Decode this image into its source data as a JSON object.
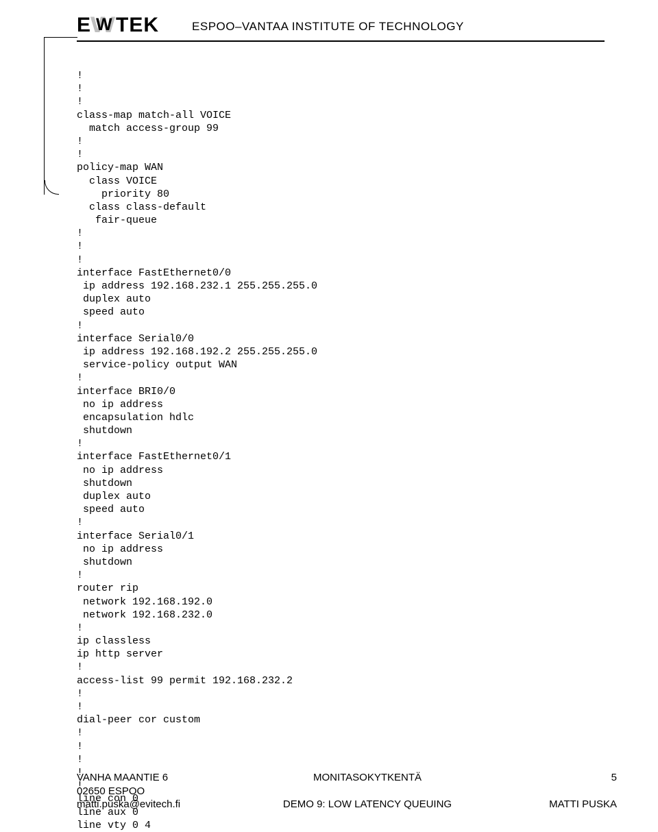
{
  "header": {
    "logo_e": "E",
    "logo_w": "W",
    "logo_tek": "TEK",
    "institute": "ESPOO–VANTAA INSTITUTE OF TECHNOLOGY"
  },
  "config_text": "!\n!\n!\nclass-map match-all VOICE\n  match access-group 99\n!\n!\npolicy-map WAN\n  class VOICE\n    priority 80\n  class class-default\n   fair-queue\n!\n!\n!\ninterface FastEthernet0/0\n ip address 192.168.232.1 255.255.255.0\n duplex auto\n speed auto\n!\ninterface Serial0/0\n ip address 192.168.192.2 255.255.255.0\n service-policy output WAN\n!\ninterface BRI0/0\n no ip address\n encapsulation hdlc\n shutdown\n!\ninterface FastEthernet0/1\n no ip address\n shutdown\n duplex auto\n speed auto\n!\ninterface Serial0/1\n no ip address\n shutdown\n!\nrouter rip\n network 192.168.192.0\n network 192.168.232.0\n!\nip classless\nip http server\n!\naccess-list 99 permit 192.168.232.2\n!\n!\ndial-peer cor custom\n!\n!\n!\n!\n!\nline con 0\nline aux 0\nline vty 0 4",
  "footer": {
    "address1": "VANHA MAANTIE 6",
    "address2": "02650 ESPOO",
    "email": "matti.puska@evitech.fi",
    "title": "MONITASOKYTKENTÄ",
    "subtitle": "DEMO 9: LOW LATENCY QUEUING",
    "page": "5",
    "author": "MATTI PUSKA"
  }
}
